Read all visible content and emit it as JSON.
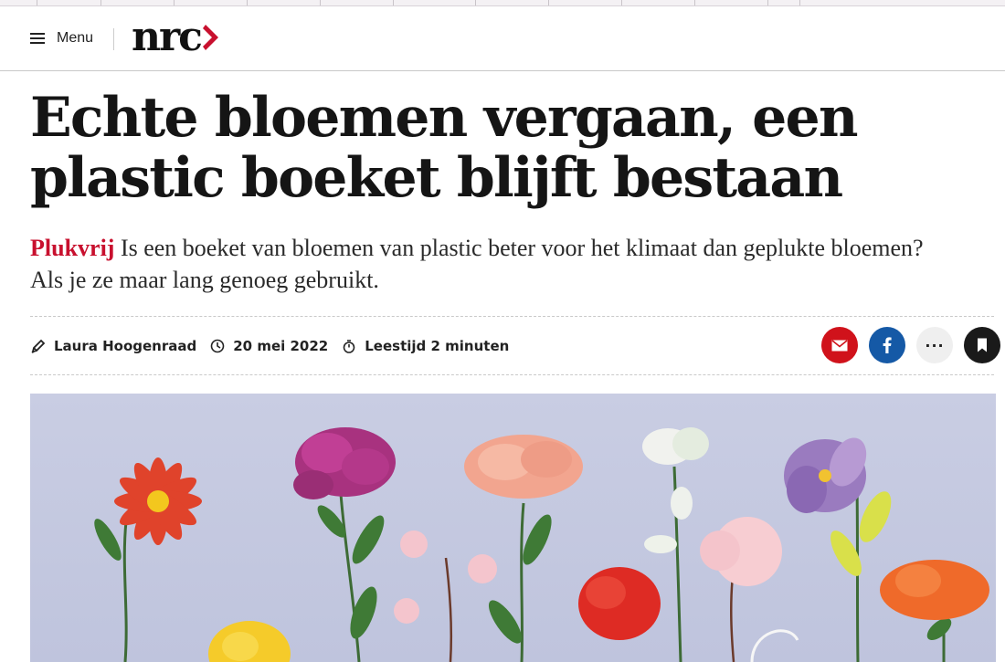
{
  "header": {
    "menu_label": "Menu",
    "logo_text": "nrc",
    "colors": {
      "brand_red": "#c8102e"
    }
  },
  "article": {
    "title": "Echte bloemen vergaan, een plastic boeket blijft bestaan",
    "kicker": "Plukvrij",
    "lead": "Is een boeket van bloemen van plastic beter voor het klimaat dan geplukte bloemen? Als je ze maar lang genoeg gebruikt.",
    "author": "Laura Hoogenraad",
    "date": "20 mei 2022",
    "reading_time": "Leestijd 2 minuten"
  },
  "share": {
    "icons": [
      "mail-icon",
      "facebook-icon",
      "more-icon",
      "bookmark-icon"
    ],
    "more_label": "···"
  }
}
